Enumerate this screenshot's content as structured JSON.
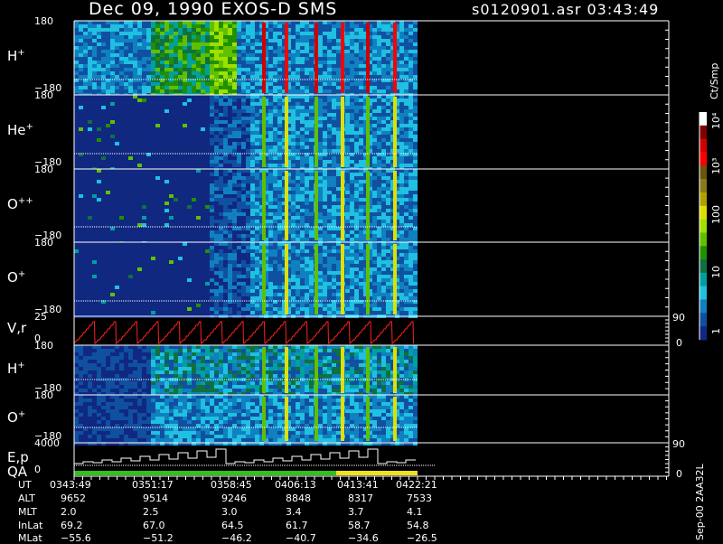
{
  "header": {
    "title": "Dec 09, 1990    EXOS-D SMS",
    "file_time": "s0120901.asr  03:43:49"
  },
  "colorbar": {
    "unit": "Ct/Smp",
    "labels": [
      "10⁴",
      "10³",
      "100",
      "10",
      "1"
    ],
    "colors": [
      "#ffffff",
      "#800000",
      "#d00000",
      "#ff0000",
      "#6a5410",
      "#8a7a1a",
      "#b0a000",
      "#e0e000",
      "#a0e000",
      "#60c000",
      "#209000",
      "#107040",
      "#00a0a0",
      "#20c0e0",
      "#1080c0",
      "#1050a0",
      "#102880"
    ]
  },
  "panels": [
    {
      "label": "H",
      "sup": "+",
      "top_tick": "180",
      "bottom_tick": "−180"
    },
    {
      "label": "He",
      "sup": "+",
      "top_tick": "180",
      "bottom_tick": "−180"
    },
    {
      "label": "O",
      "sup": "++",
      "top_tick": "180",
      "bottom_tick": "−180"
    },
    {
      "label": "O",
      "sup": "+",
      "top_tick": "180",
      "bottom_tick": "−180"
    },
    {
      "label": "V,r",
      "sup": "",
      "top_tick": "25",
      "bottom_tick": "0",
      "right_top": "90",
      "right_bottom": "0"
    },
    {
      "label": "H",
      "sup": "+",
      "top_tick": "180",
      "bottom_tick": "−180"
    },
    {
      "label": "O",
      "sup": "+",
      "top_tick": "180",
      "bottom_tick": "−180"
    },
    {
      "label": "E,p",
      "label2": "QA",
      "sup": "",
      "top_tick": "4000",
      "bottom_tick": "0",
      "right_top": "90",
      "right_bottom": "0"
    }
  ],
  "footer_stamp": "Sep-00  2AA32L",
  "ephemeris": {
    "row_labels": [
      "UT",
      "ALT",
      "MLT",
      "InLat",
      "MLat"
    ],
    "columns": [
      [
        "0343:49",
        "9652",
        "2.0",
        "69.2",
        "−55.6"
      ],
      [
        "0351:17",
        "9514",
        "2.5",
        "67.0",
        "−51.2"
      ],
      [
        "0358:45",
        "9246",
        "3.0",
        "64.5",
        "−46.2"
      ],
      [
        "0406:13",
        "8848",
        "3.4",
        "61.7",
        "−40.7"
      ],
      [
        "0413:41",
        "8317",
        "3.7",
        "58.7",
        "−34.6"
      ],
      [
        "0422:21",
        "7533",
        "4.1",
        "54.8",
        "−26.5"
      ]
    ]
  },
  "chart_data": {
    "type": "heatmap",
    "title": "Dec 09, 1990    EXOS-D SMS",
    "x_ticks": [
      "0343:49",
      "0351:17",
      "0358:45",
      "0406:13",
      "0413:41",
      "0422:21"
    ],
    "color_scale": "log",
    "color_range": [
      1,
      10000
    ],
    "color_unit": "Ct/Smp",
    "panels": [
      "H+",
      "He+",
      "O++",
      "O+",
      "V,r",
      "H+",
      "O+",
      "E,p / QA"
    ]
  }
}
